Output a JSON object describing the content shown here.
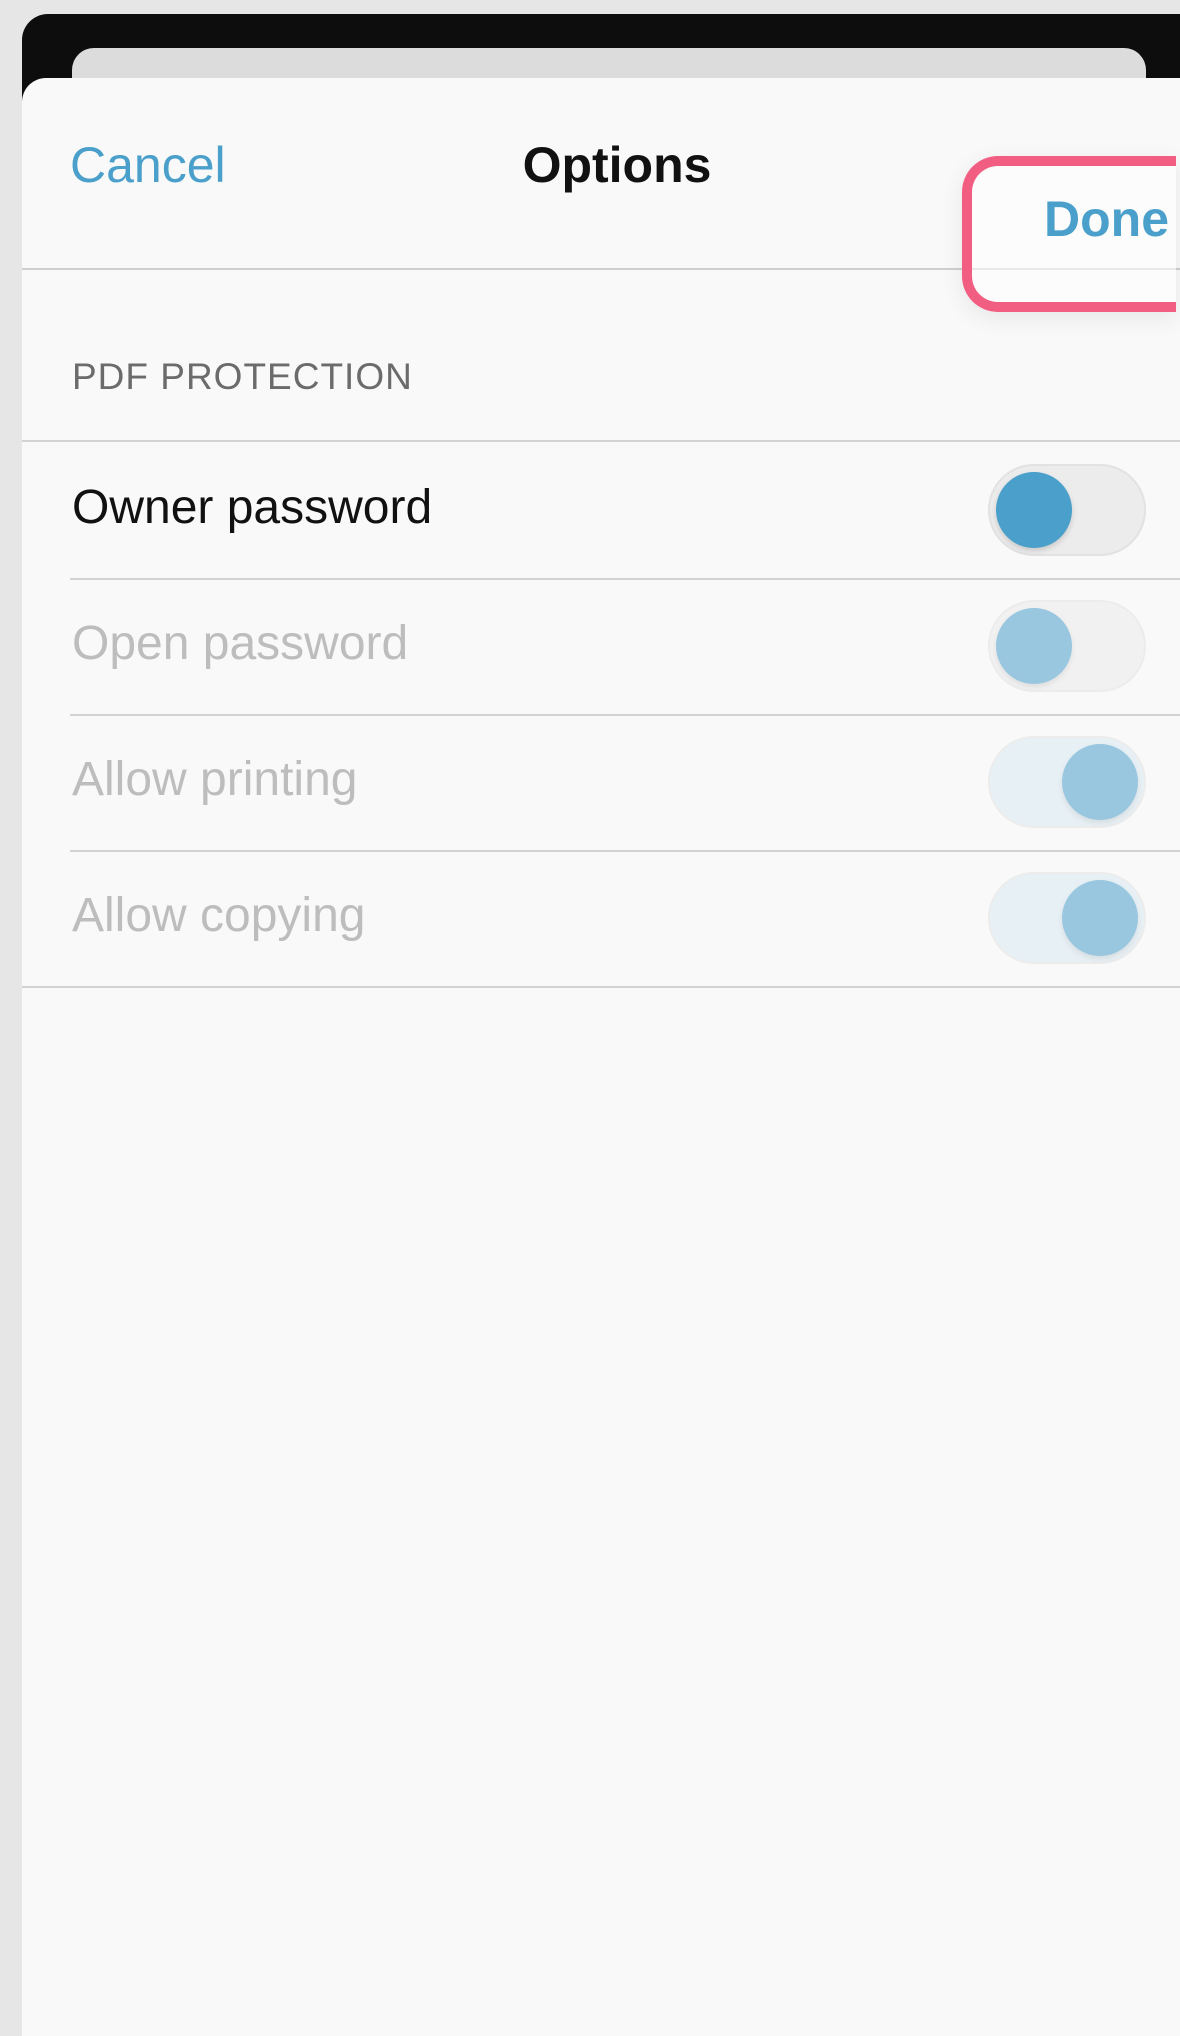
{
  "navbar": {
    "cancel_label": "Cancel",
    "title": "Options",
    "done_label": "Done"
  },
  "section": {
    "header": "PDF PROTECTION"
  },
  "rows": [
    {
      "label": "Owner password",
      "state": "off",
      "enabled": true
    },
    {
      "label": "Open password",
      "state": "off",
      "enabled": false
    },
    {
      "label": "Allow printing",
      "state": "on",
      "enabled": false
    },
    {
      "label": "Allow copying",
      "state": "on",
      "enabled": false
    }
  ],
  "colors": {
    "accent": "#4a9fcb",
    "highlight": "#f25d82"
  }
}
